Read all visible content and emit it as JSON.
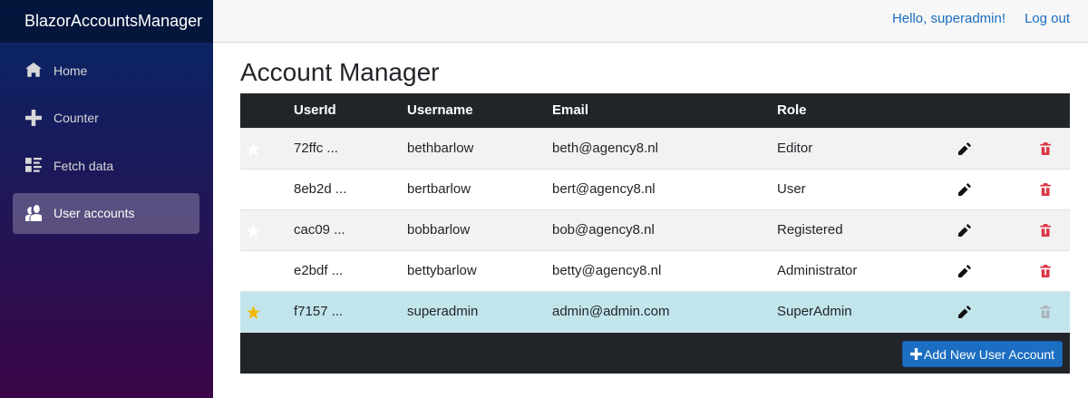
{
  "app": {
    "brand": "BlazorAccountsManager"
  },
  "nav": {
    "items": [
      {
        "label": "Home",
        "icon": "home-icon",
        "active": false
      },
      {
        "label": "Counter",
        "icon": "plus-icon",
        "active": false
      },
      {
        "label": "Fetch data",
        "icon": "list-rich-icon",
        "active": false
      },
      {
        "label": "User accounts",
        "icon": "people-icon",
        "active": true
      }
    ]
  },
  "topbar": {
    "greeting": "Hello, superadmin!",
    "logout": "Log out"
  },
  "page": {
    "title": "Account Manager"
  },
  "table": {
    "headers": {
      "star": "",
      "userid": "UserId",
      "username": "Username",
      "email": "Email",
      "role": "Role"
    },
    "rows": [
      {
        "userid": "72ffc ...",
        "username": "bethbarlow",
        "email": "beth@agency8.nl",
        "role": "Editor",
        "current": false
      },
      {
        "userid": "8eb2d ...",
        "username": "bertbarlow",
        "email": "bert@agency8.nl",
        "role": "User",
        "current": false
      },
      {
        "userid": "cac09 ...",
        "username": "bobbarlow",
        "email": "bob@agency8.nl",
        "role": "Registered",
        "current": false
      },
      {
        "userid": "e2bdf ...",
        "username": "bettybarlow",
        "email": "betty@agency8.nl",
        "role": "Administrator",
        "current": false
      },
      {
        "userid": "f7157 ...",
        "username": "superadmin",
        "email": "admin@admin.com",
        "role": "SuperAdmin",
        "current": true
      }
    ],
    "add_button": "Add New User Account"
  },
  "colors": {
    "star_active": "#f5b800",
    "star_inactive": "#ffffff",
    "delete": "#dc3545",
    "delete_disabled": "#a9b4b8",
    "accent": "#1b6ec2"
  }
}
